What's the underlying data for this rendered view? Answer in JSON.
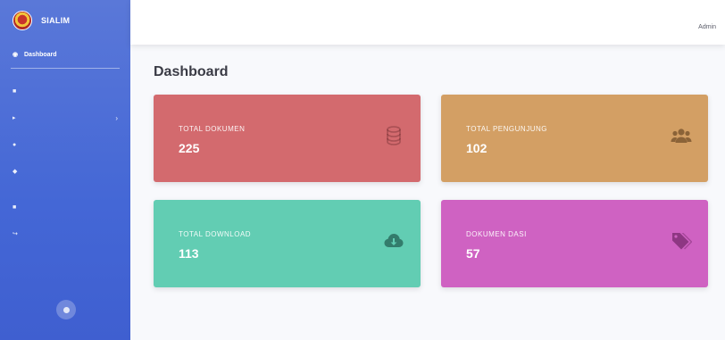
{
  "brand": {
    "name": "SIALIM",
    "suffix": ""
  },
  "sidebar": {
    "items": [
      {
        "label": "Dashboard",
        "icon": "dashboard-icon"
      },
      {
        "label": "",
        "heading": true
      },
      {
        "label": "",
        "icon": "users-icon"
      },
      {
        "label": "",
        "icon": "folder-icon"
      },
      {
        "label": "",
        "icon": "upload-icon"
      },
      {
        "label": "",
        "icon": "tag-icon"
      },
      {
        "label": "",
        "heading": true
      },
      {
        "label": "",
        "icon": "user-icon"
      },
      {
        "label": "",
        "icon": "logout-icon"
      }
    ]
  },
  "topbar": {
    "user": "Admin"
  },
  "page": {
    "title": "Dashboard"
  },
  "cards": [
    {
      "label": "TOTAL DOKUMEN",
      "value": "225",
      "color": "#d36a6e",
      "icon": "database-icon"
    },
    {
      "label": "TOTAL PENGUNJUNG",
      "value": "102",
      "color": "#d39f64",
      "icon": "users-icon"
    },
    {
      "label": "TOTAL DOWNLOAD",
      "value": "113",
      "color": "#62cdb3",
      "icon": "cloud-download-icon"
    },
    {
      "label": "DOKUMEN DASI",
      "value": "57",
      "color": "#cf62c2",
      "icon": "tags-icon"
    }
  ]
}
